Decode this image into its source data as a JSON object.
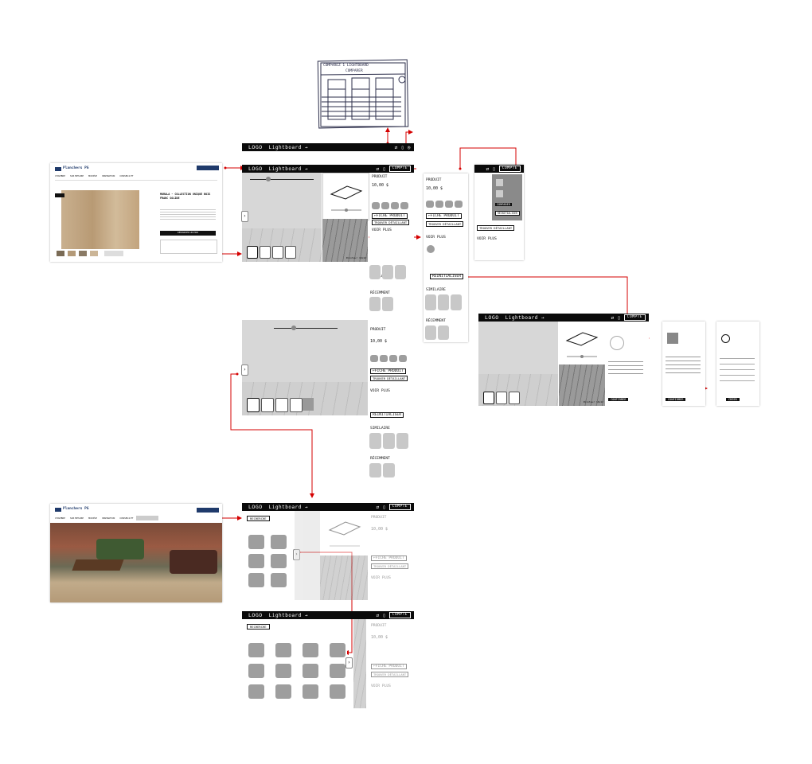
{
  "colors": {
    "arrow": "#d50000",
    "brand": "#1f3a6b",
    "bar": "#0a0a0a"
  },
  "top_sketch": {
    "title": "COMPAREZ 1 LIGHTBOARD",
    "subtitle": "COMPARER"
  },
  "website": {
    "brand": "Planchers PG",
    "nav": [
      "CHAMBRE",
      "SUR MESURE",
      "MODÈLE",
      "INSPIRATION",
      "CONSEILS ET"
    ],
    "product_title": "MORALA - COLLECTION UNIQUE BOIS FRANC SOLIDE",
    "cta": "DEMANDER UN PRIX"
  },
  "wireframe": {
    "logo": "LOGO",
    "nav": "Lightboard →",
    "account": "COMPTE",
    "product_label": "PRODUIT",
    "price": "10,00 $",
    "tag": "Pointeur 16x12",
    "fiche": "←FICHE PRODUIT",
    "retailer": "TROUVER DÉTAILLANT",
    "see_more": "VOIR PLUS",
    "reset": "RÉINITIALISER",
    "similar": "SIMILAIRE",
    "recent": "RÉCEMMENT",
    "search": "RECHERCHE",
    "confirm": "CONFIRMER",
    "create": "CRÉER",
    "compare": "COMPARER",
    "reinit2": "RÉINITIALISER"
  }
}
